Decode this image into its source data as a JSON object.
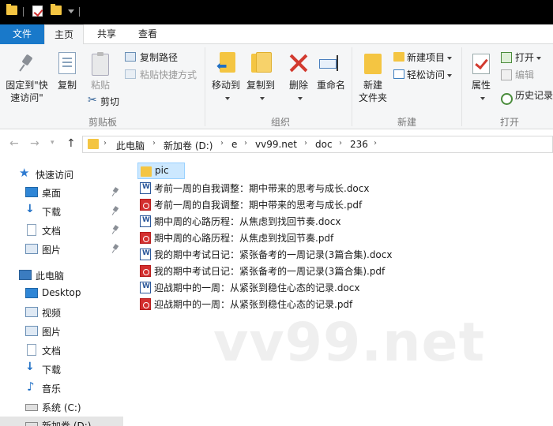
{
  "ribbon_tabs": {
    "file": "文件",
    "home": "主页",
    "share": "共享",
    "view": "查看"
  },
  "clipboard": {
    "pin_label_1": "固定到\"快",
    "pin_label_2": "速访问\"",
    "copy": "复制",
    "paste": "粘贴",
    "copy_path": "复制路径",
    "paste_shortcut": "粘贴快捷方式",
    "cut": "剪切",
    "group": "剪贴板"
  },
  "organize": {
    "move_to": "移动到",
    "copy_to": "复制到",
    "delete": "删除",
    "rename": "重命名",
    "group": "组织"
  },
  "new": {
    "new_folder_1": "新建",
    "new_folder_2": "文件夹",
    "new_item": "新建项目",
    "easy_access": "轻松访问",
    "group": "新建"
  },
  "open": {
    "properties": "属性",
    "open": "打开",
    "edit": "编辑",
    "history": "历史记录",
    "group": "打开"
  },
  "breadcrumb": [
    "此电脑",
    "新加卷 (D:)",
    "e",
    "vv99.net",
    "doc",
    "236"
  ],
  "nav_pane": {
    "quick_access": "快速访问",
    "qa_items": [
      "桌面",
      "下载",
      "文档",
      "图片"
    ],
    "this_pc": "此电脑",
    "pc_items": [
      "Desktop",
      "视频",
      "图片",
      "文档",
      "下载",
      "音乐",
      "系统 (C:)",
      "新加卷 (D:)"
    ]
  },
  "files": [
    {
      "name": "pic",
      "type": "folder"
    },
    {
      "name": "考前一周的自我调整：期中带来的思考与成长.docx",
      "type": "docx"
    },
    {
      "name": "考前一周的自我调整：期中带来的思考与成长.pdf",
      "type": "pdf"
    },
    {
      "name": "期中周的心路历程：从焦虑到找回节奏.docx",
      "type": "docx"
    },
    {
      "name": "期中周的心路历程：从焦虑到找回节奏.pdf",
      "type": "pdf"
    },
    {
      "name": "我的期中考试日记：紧张备考的一周记录(3篇合集).docx",
      "type": "docx"
    },
    {
      "name": "我的期中考试日记：紧张备考的一周记录(3篇合集).pdf",
      "type": "pdf"
    },
    {
      "name": "迎战期中的一周：从紧张到稳住心态的记录.docx",
      "type": "docx"
    },
    {
      "name": "迎战期中的一周：从紧张到稳住心态的记录.pdf",
      "type": "pdf"
    }
  ],
  "watermark": "vv99.net",
  "colors": {
    "file_tab": "#1979ca",
    "selection": "#cce8ff",
    "folder": "#f4c542"
  }
}
